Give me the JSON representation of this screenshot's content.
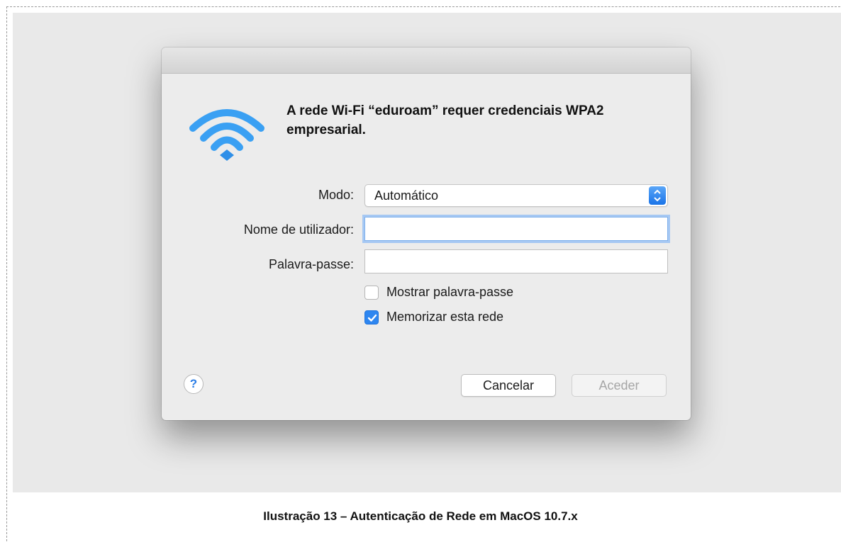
{
  "dialog": {
    "heading": "A rede Wi-Fi “eduroam” requer credenciais WPA2 empresarial.",
    "icon": "wifi-icon",
    "mode": {
      "label": "Modo:",
      "value": "Automático"
    },
    "username": {
      "label": "Nome de utilizador:",
      "value": ""
    },
    "password": {
      "label": "Palavra-passe:",
      "value": ""
    },
    "show_password": {
      "label": "Mostrar palavra-passe",
      "checked": false
    },
    "remember_network": {
      "label": "Memorizar esta rede",
      "checked": true
    },
    "help_label": "?",
    "cancel_label": "Cancelar",
    "ok_label": "Aceder"
  },
  "caption": "Ilustração 13 – Autenticação de Rede em MacOS 10.7.x",
  "colors": {
    "accent": "#2e86f0",
    "wifi": "#3aa0f3"
  }
}
